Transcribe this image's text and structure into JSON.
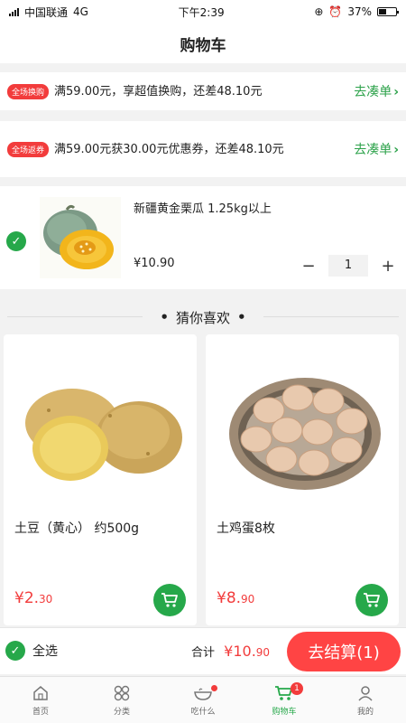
{
  "status_bar": {
    "carrier": "中国联通",
    "network": "4G",
    "time": "下午2:39",
    "battery": "37%"
  },
  "nav": {
    "title": "购物车"
  },
  "promos": [
    {
      "tag": "全场换购",
      "text": "满59.00元，享超值换购，还差48.10元",
      "link": "去凑单"
    },
    {
      "tag": "全场返券",
      "text": "满59.00元获30.00元优惠券，还差48.10元",
      "link": "去凑单"
    }
  ],
  "cart_item": {
    "name": "新疆黄金栗瓜 1.25kg以上",
    "price": "¥10.90",
    "quantity": "1",
    "minus": "−",
    "plus": "+"
  },
  "recommend": {
    "title": "猜你喜欢",
    "products": [
      {
        "name": "土豆（黄心） 约500g",
        "price_int": "¥2.",
        "price_dec": "30"
      },
      {
        "name": "土鸡蛋8枚",
        "price_int": "¥8.",
        "price_dec": "90"
      }
    ]
  },
  "checkout": {
    "select_all": "全选",
    "total_label": "合计",
    "total_int": "¥10.",
    "total_dec": "90",
    "button": "去结算(1)"
  },
  "tabs": [
    {
      "label": "首页",
      "icon": "home-icon"
    },
    {
      "label": "分类",
      "icon": "category-icon"
    },
    {
      "label": "吃什么",
      "icon": "bowl-icon"
    },
    {
      "label": "购物车",
      "icon": "cart-icon",
      "badge": "1"
    },
    {
      "label": "我的",
      "icon": "user-icon"
    }
  ],
  "colors": {
    "accent_green": "#26a84a",
    "accent_red": "#f23c3c"
  }
}
